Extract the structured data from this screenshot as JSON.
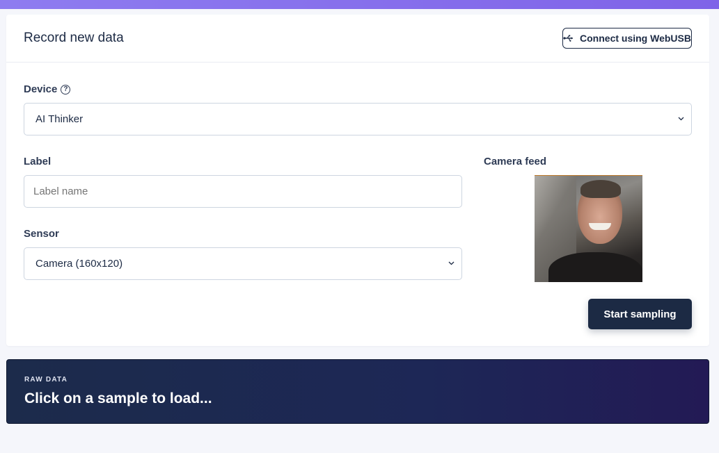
{
  "card": {
    "title": "Record new data",
    "webusb_label": "Connect using WebUSB"
  },
  "device": {
    "label": "Device",
    "help_glyph": "?",
    "selected": "AI Thinker"
  },
  "label_field": {
    "label": "Label",
    "placeholder": "Label name"
  },
  "sensor": {
    "label": "Sensor",
    "selected": "Camera (160x120)"
  },
  "camera": {
    "label": "Camera feed"
  },
  "actions": {
    "start_label": "Start sampling"
  },
  "raw_data": {
    "kicker": "RAW DATA",
    "title": "Click on a sample to load..."
  },
  "icons": {
    "usb": "usb-icon",
    "help": "help-circle-icon",
    "chevron": "chevron-down-icon"
  },
  "colors": {
    "primary": "#1c2a44",
    "topbar": "#8e7cf0",
    "background": "#f5f6fb"
  }
}
